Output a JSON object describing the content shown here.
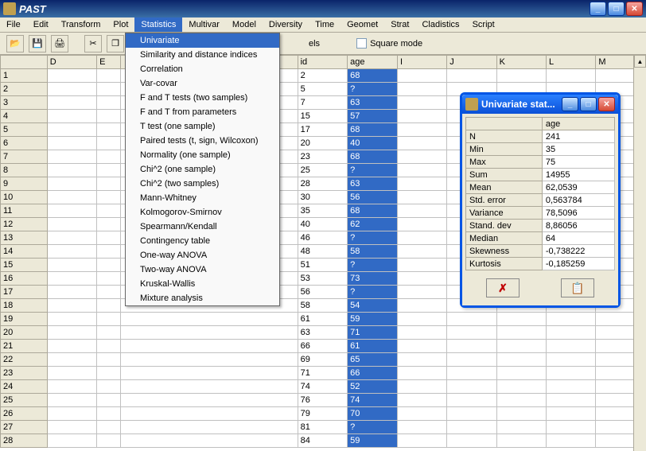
{
  "app": {
    "title": "PAST"
  },
  "menu": {
    "items": [
      "File",
      "Edit",
      "Transform",
      "Plot",
      "Statistics",
      "Multivar",
      "Model",
      "Diversity",
      "Time",
      "Geomet",
      "Strat",
      "Cladistics",
      "Script"
    ],
    "active_index": 4
  },
  "toolbar": {
    "dropdown_suffix": "els",
    "square_mode_label": "Square mode",
    "square_mode_checked": false
  },
  "dropdown": {
    "items": [
      "Univariate",
      "Similarity and distance indices",
      "Correlation",
      "Var-covar",
      "F and T tests (two samples)",
      "F and T from parameters",
      "T test (one sample)",
      "Paired tests (t, sign, Wilcoxon)",
      "Normality (one sample)",
      "Chi^2 (one sample)",
      "Chi^2 (two samples)",
      "Mann-Whitney",
      "Kolmogorov-Smirnov",
      "Spearmann/Kendall",
      "Contingency table",
      "One-way ANOVA",
      "Two-way ANOVA",
      "Kruskal-Wallis",
      "Mixture analysis"
    ],
    "highlighted_index": 0
  },
  "sheet": {
    "col_headers": [
      "",
      "D",
      "E",
      "",
      "id",
      "age",
      "I",
      "J",
      "K",
      "L",
      "M"
    ],
    "rows": [
      {
        "n": "1",
        "id": "2",
        "age": "68"
      },
      {
        "n": "2",
        "id": "5",
        "age": "?"
      },
      {
        "n": "3",
        "id": "7",
        "age": "63"
      },
      {
        "n": "4",
        "id": "15",
        "age": "57"
      },
      {
        "n": "5",
        "id": "17",
        "age": "68"
      },
      {
        "n": "6",
        "id": "20",
        "age": "40"
      },
      {
        "n": "7",
        "id": "23",
        "age": "68"
      },
      {
        "n": "8",
        "id": "25",
        "age": "?"
      },
      {
        "n": "9",
        "id": "28",
        "age": "63"
      },
      {
        "n": "10",
        "id": "30",
        "age": "56"
      },
      {
        "n": "11",
        "id": "35",
        "age": "68"
      },
      {
        "n": "12",
        "id": "40",
        "age": "62"
      },
      {
        "n": "13",
        "id": "46",
        "age": "?"
      },
      {
        "n": "14",
        "id": "48",
        "age": "58"
      },
      {
        "n": "15",
        "id": "51",
        "age": "?"
      },
      {
        "n": "16",
        "id": "53",
        "age": "73"
      },
      {
        "n": "17",
        "id": "56",
        "age": "?"
      },
      {
        "n": "18",
        "id": "58",
        "age": "54"
      },
      {
        "n": "19",
        "id": "61",
        "age": "59"
      },
      {
        "n": "20",
        "id": "63",
        "age": "71"
      },
      {
        "n": "21",
        "id": "66",
        "age": "61"
      },
      {
        "n": "22",
        "id": "69",
        "age": "65"
      },
      {
        "n": "23",
        "id": "71",
        "age": "66"
      },
      {
        "n": "24",
        "id": "74",
        "age": "52"
      },
      {
        "n": "25",
        "id": "76",
        "age": "74"
      },
      {
        "n": "26",
        "id": "79",
        "age": "70"
      },
      {
        "n": "27",
        "id": "81",
        "age": "?"
      },
      {
        "n": "28",
        "id": "84",
        "age": "59"
      }
    ]
  },
  "stat_window": {
    "title": "Univariate stat...",
    "column_label": "age",
    "rows": [
      {
        "label": "N",
        "value": "241"
      },
      {
        "label": "Min",
        "value": "35"
      },
      {
        "label": "Max",
        "value": "75"
      },
      {
        "label": "Sum",
        "value": "14955"
      },
      {
        "label": "Mean",
        "value": "62,0539"
      },
      {
        "label": "Std. error",
        "value": "0,563784"
      },
      {
        "label": "Variance",
        "value": "78,5096"
      },
      {
        "label": "Stand. dev",
        "value": "8,86056"
      },
      {
        "label": "Median",
        "value": "64"
      },
      {
        "label": "Skewness",
        "value": "-0,738222"
      },
      {
        "label": "Kurtosis",
        "value": "-0,185259"
      }
    ],
    "cancel_glyph": "✗"
  }
}
